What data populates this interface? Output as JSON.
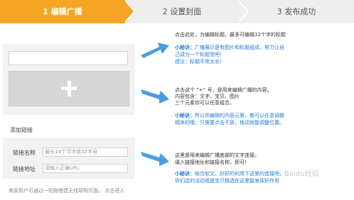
{
  "steps": [
    {
      "label": "1  编辑广播",
      "active": true
    },
    {
      "label": "2  设置封面",
      "active": false
    },
    {
      "label": "3  发布成功",
      "active": false
    }
  ],
  "colors": {
    "active_step": "#f5a623",
    "inactive_step": "#eeeeee",
    "arrow": "#4a9ee0",
    "tip_text": "#1e7ad6"
  },
  "editor": {
    "title_input_value": "",
    "add_icon": "plus-icon"
  },
  "links": {
    "section_label": "添加链接",
    "name_label": "链接名称",
    "name_placeholder": "最长14个汉字或32字母",
    "url_label": "链接地址",
    "url_placeholder": "请输入正确URL",
    "footer_text": "卖家用户可通过一阳指搭建无线导购页面。 点击进入"
  },
  "annotations": {
    "a1": {
      "line1": "点击此处，为编辑标题，最多可编辑32个字的标题",
      "tip_title": "小秘诀：",
      "tip1": "广播展示是有图片和标题组成，努力让自",
      "tip2": "己成为一个标题党吧！",
      "tip3": "建议：标题不用太长！"
    },
    "a2": {
      "line1": "点击这个 “+” 号，是用来编辑广播的内容。",
      "line2": "内容包含：文字、宝贝、图片",
      "line3": "三个元素你可以任意组合。",
      "tip_title": "小秘诀：",
      "tip1": "所以你编辑的内容元素，都可以任意调换",
      "tip2": "顺序的哦，只需要点击不放，拖动就能调整位置。"
    },
    "a3": {
      "line1": "这里是用来编辑广播底部的文字连接。",
      "line2": "填入链接地址和链接名称，即可！",
      "tip_title": "小秘诀：",
      "tip1": "结合软文，好好的利用下这里的连接吧，",
      "tip2": "你们店的活动或是宝贝精选在这里能发挥好作用"
    }
  },
  "watermark": "Baidu经验"
}
